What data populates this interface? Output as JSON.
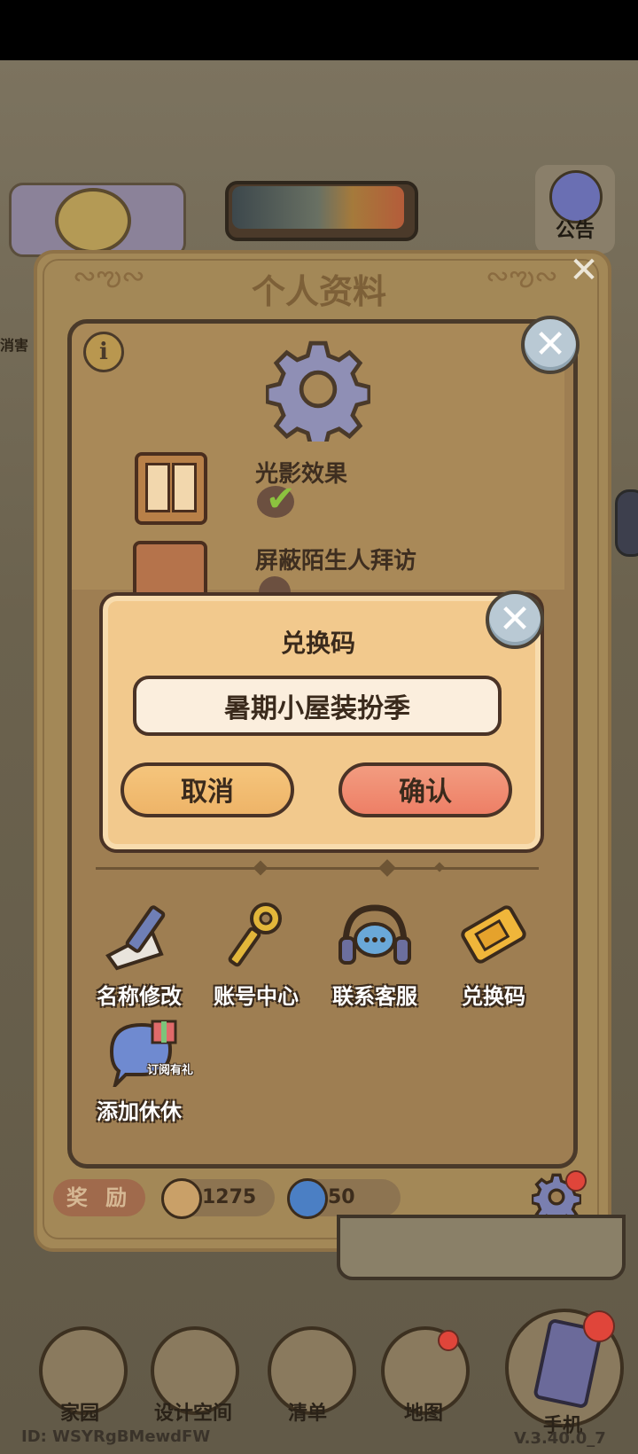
{
  "background": {
    "notice_label": "公告",
    "left_hint": "消害"
  },
  "profile": {
    "title": "个人资料",
    "settings": [
      {
        "label": "光影效果",
        "state": "on"
      },
      {
        "label": "屏蔽陌生人拜访",
        "state": "off"
      }
    ],
    "tools": [
      {
        "label": "名称修改",
        "icon": "pencil-icon"
      },
      {
        "label": "账号中心",
        "icon": "key-icon"
      },
      {
        "label": "联系客服",
        "icon": "headset-icon"
      },
      {
        "label": "兑换码",
        "icon": "ticket-icon"
      },
      {
        "label": "添加休休",
        "icon": "chat-gift-icon",
        "badge": "订阅有礼"
      }
    ],
    "reward_label": "奖 励",
    "coins": "1275",
    "gems": "50"
  },
  "dialog": {
    "title": "兑换码",
    "code_value": "暑期小屋装扮季",
    "cancel_label": "取消",
    "confirm_label": "确认"
  },
  "nav": {
    "items": [
      "家园",
      "设计空间",
      "清单",
      "地图"
    ],
    "phone_label": "手机"
  },
  "footer": {
    "id_text": "ID:  WSYRgBMewdFW",
    "version": "V.3.40.0_7"
  },
  "colors": {
    "dialog_bg": "#f2c98d",
    "confirm_btn": "#ee7f66",
    "cancel_btn": "#eeb468",
    "panel_bg": "#9e7e52"
  }
}
